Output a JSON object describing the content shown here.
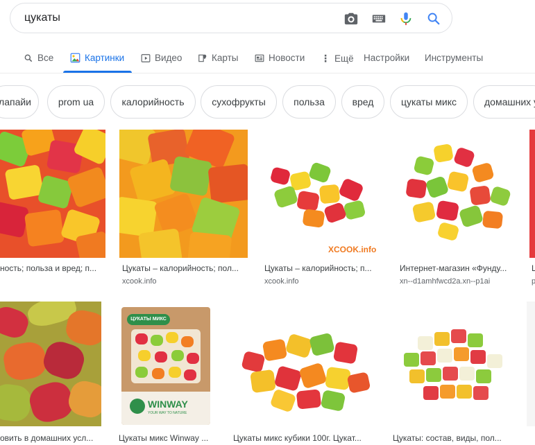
{
  "search": {
    "query": "цукаты"
  },
  "icons": {
    "camera": "camera-icon",
    "keyboard": "keyboard-icon",
    "mic": "microphone-icon",
    "search": "search-icon"
  },
  "tabs": [
    {
      "label": "Все",
      "icon": "search-icon"
    },
    {
      "label": "Картинки",
      "icon": "image-icon",
      "active": true
    },
    {
      "label": "Видео",
      "icon": "video-icon"
    },
    {
      "label": "Карты",
      "icon": "map-icon"
    },
    {
      "label": "Новости",
      "icon": "news-icon"
    },
    {
      "label": "Ещё",
      "icon": "more-vert-icon"
    },
    {
      "label": "Настройки"
    },
    {
      "label": "Инструменты"
    }
  ],
  "chips": [
    "лапайи",
    "prom ua",
    "калорийность",
    "сухофрукты",
    "польза",
    "вред",
    "цукаты микс",
    "домашних у"
  ],
  "results_row1": [
    {
      "caption": "ность; польза и вред; п...",
      "source": ""
    },
    {
      "caption": "Цукаты – калорийность; пол...",
      "source": "xcook.info"
    },
    {
      "caption": "Цукаты – калорийность; п...",
      "source": "xcook.info",
      "watermark": "XCOOK.info"
    },
    {
      "caption": "Интернет-магазин «Фунду...",
      "source": "xn--d1amhfwcd2a.xn--p1ai"
    },
    {
      "caption": "Ц",
      "source": "р"
    }
  ],
  "results_row2": [
    {
      "caption": "овить в домашних усл...",
      "source": ""
    },
    {
      "caption": "Цукаты микс Winway ...",
      "source": "",
      "package_brand": "WINWAY",
      "package_slogan": "YOUR WAY TO NATURE",
      "package_label": "ЦУКАТЫ МИКС"
    },
    {
      "caption": "Цукаты микс кубики 100г. Цукат...",
      "source": ""
    },
    {
      "caption": "Цукаты: состав, виды, пол...",
      "source": ""
    }
  ],
  "colors": {
    "accent": "#1a73e8",
    "mic_blue": "#4285f4",
    "mic_red": "#ea4335",
    "mic_yellow": "#fbbc04",
    "mic_green": "#34a853"
  }
}
